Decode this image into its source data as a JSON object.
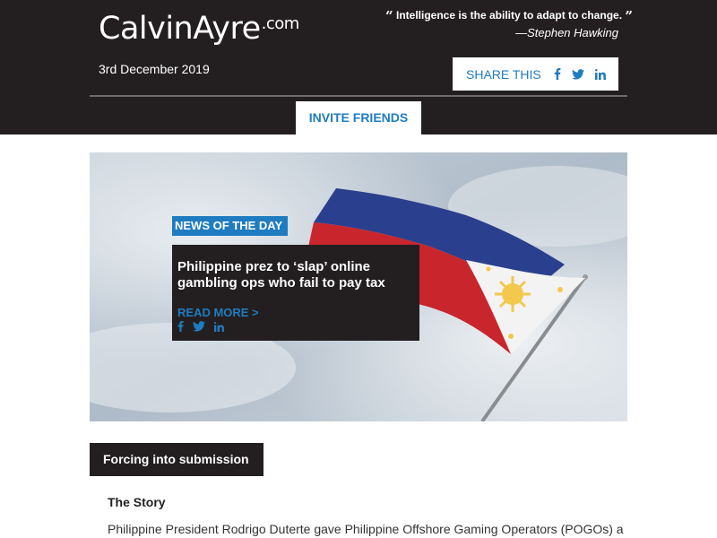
{
  "header": {
    "logo_main": "CalvinAyre",
    "logo_suffix": ".com",
    "quote_open": "“",
    "quote_text": "Intelligence is the ability to adapt to change.",
    "quote_close": "”",
    "quote_author": "—Stephen Hawking",
    "date": "3rd December 2019",
    "share_label": "SHARE THIS",
    "share_icons": [
      "facebook-icon",
      "twitter-icon",
      "linkedin-icon"
    ],
    "invite_label": "INVITE FRIENDS"
  },
  "hero": {
    "tag": "NEWS OF THE DAY",
    "title": "Philippine prez to ‘slap’ online gambling ops who fail to pay tax",
    "read_more": "READ MORE >",
    "social_icons": [
      "facebook-icon",
      "twitter-icon",
      "linkedin-icon"
    ]
  },
  "section": {
    "tab_label": "Forcing into submission",
    "story_heading": "The Story",
    "story_text": "Philippine President Rodrigo Duterte gave Philippine Offshore Gaming Operators (POGOs) a"
  },
  "colors": {
    "header_bg": "#231f20",
    "accent_blue": "#1f7cc0",
    "white": "#ffffff",
    "flag_blue": "#2b3f8f",
    "flag_red": "#c8262c",
    "flag_yellow": "#f2c94c"
  }
}
